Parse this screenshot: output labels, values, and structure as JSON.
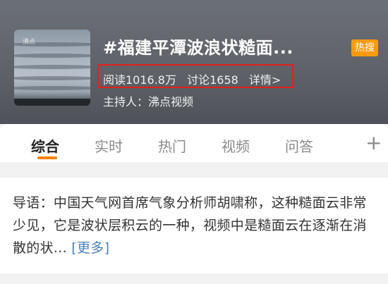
{
  "topic": {
    "title": "#福建平潭波浪状糙面...",
    "badge": "热搜",
    "read_count": "阅读1016.8万",
    "discuss_count": "讨论1658",
    "details_link": "详情>",
    "host": "主持人：沸点视频",
    "thumbnail_watermark": "沸点"
  },
  "tabs": [
    {
      "label": "综合",
      "active": true
    },
    {
      "label": "实时",
      "active": false
    },
    {
      "label": "热门",
      "active": false
    },
    {
      "label": "视频",
      "active": false
    },
    {
      "label": "问答",
      "active": false
    }
  ],
  "add_tab_label": "+",
  "intro": {
    "text": "导语：中国天气网首席气象分析师胡啸称，这种糙面云非常少见，它是波状层积云的一种，视频中是糙面云在逐渐在消散的状...",
    "more_link": "[更多]"
  },
  "colors": {
    "accent": "#ff8200",
    "badge": "#ff9a0e",
    "highlight_border": "#e0211b",
    "link": "#4a7fbf"
  }
}
